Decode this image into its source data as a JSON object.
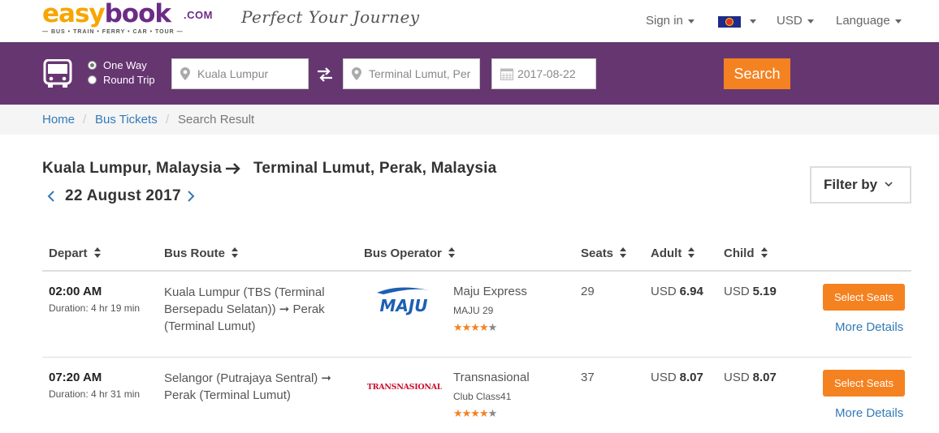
{
  "header": {
    "logo_easy": "easy",
    "logo_book": "book",
    "logo_com": ".COM",
    "logo_services": "— BUS • TRAIN • FERRY • CAR • TOUR —",
    "tagline": "Perfect Your Journey",
    "sign_in": "Sign in",
    "currency": "USD",
    "language": "Language",
    "flag_icon": "asean-flag-icon"
  },
  "search": {
    "trip_options": [
      "One Way",
      "Round Trip"
    ],
    "selected_trip": "One Way",
    "from": "Kuala Lumpur",
    "to": "Terminal Lumut, Per",
    "date": "2017-08-22",
    "button": "Search"
  },
  "breadcrumb": {
    "home": "Home",
    "bus_tickets": "Bus Tickets",
    "current": "Search Result",
    "separator": "/"
  },
  "results": {
    "from": "Kuala Lumpur, Malaysia",
    "to": "Terminal Lumut, Perak, Malaysia",
    "date": "22 August 2017",
    "filter": "Filter by"
  },
  "table": {
    "headers": {
      "depart": "Depart",
      "route": "Bus Route",
      "operator": "Bus Operator",
      "seats": "Seats",
      "adult": "Adult",
      "child": "Child"
    },
    "rows": [
      {
        "time": "02:00 AM",
        "duration": "Duration: 4 hr 19 min",
        "route": "Kuala Lumpur (TBS (Terminal Bersepadu Selatan)) ➞ Perak (Terminal Lumut)",
        "operator_logo": "MAJU",
        "operator": "Maju Express",
        "bus_class": "MAJU 29",
        "rating": 4,
        "seats": "29",
        "adult_currency": "USD",
        "adult_price": "6.94",
        "child_currency": "USD",
        "child_price": "5.19",
        "select": "Select Seats",
        "details": "More Details"
      },
      {
        "time": "07:20 AM",
        "duration": "Duration: 4 hr 31 min",
        "route": "Selangor (Putrajaya Sentral) ➞ Perak (Terminal Lumut)",
        "operator_logo": "TRANSNASIONAL",
        "operator": "Transnasional",
        "bus_class": "Club Class41",
        "rating": 4,
        "seats": "37",
        "adult_currency": "USD",
        "adult_price": "8.07",
        "child_currency": "USD",
        "child_price": "8.07",
        "select": "Select Seats",
        "details": "More Details"
      }
    ]
  },
  "colors": {
    "brand_purple": "#663671",
    "accent_orange": "#f58220",
    "link_blue": "#337ab7",
    "logo_yellow": "#f7a600"
  }
}
